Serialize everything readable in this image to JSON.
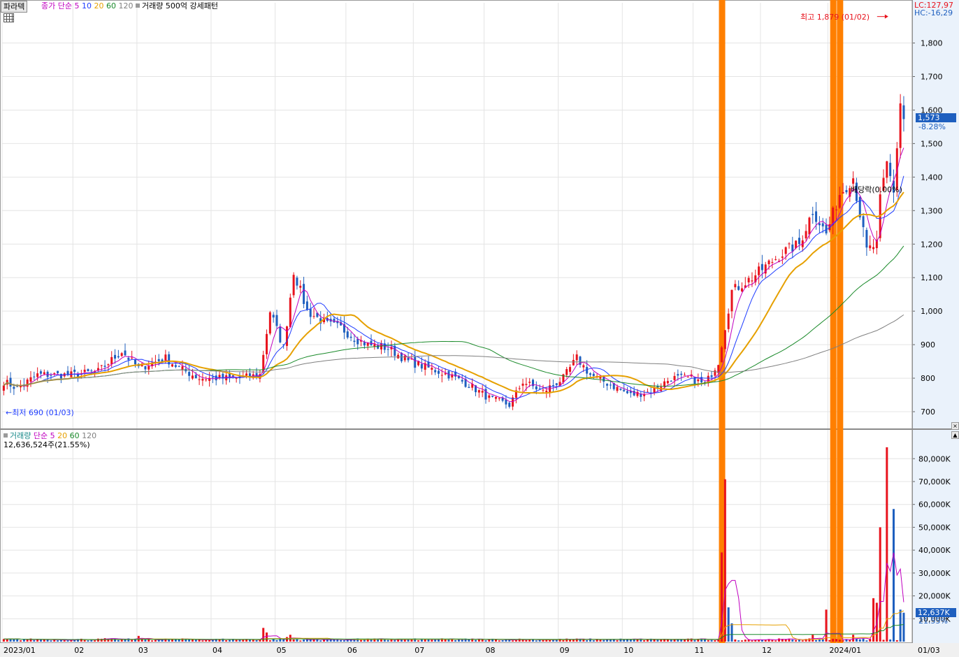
{
  "header": {
    "stock_name": "파라텍",
    "price_legend": {
      "label": "종가 단순",
      "periods": [
        {
          "value": "5",
          "color": "#c000c0"
        },
        {
          "value": "10",
          "color": "#1e3cff"
        },
        {
          "value": "20",
          "color": "#e6a000"
        },
        {
          "value": "60",
          "color": "#1a8a2a"
        },
        {
          "value": "120",
          "color": "#808080"
        }
      ]
    },
    "pattern_label": "거래량 500억 강세패턴",
    "lc": "LC:127,97",
    "hc": "HC:-16,29"
  },
  "volume_header": {
    "label": "거래량",
    "ma_label": "단순",
    "periods": [
      {
        "value": "5",
        "color": "#c000c0"
      },
      {
        "value": "20",
        "color": "#e6a000"
      },
      {
        "value": "60",
        "color": "#1a8a2a"
      },
      {
        "value": "120",
        "color": "#808080"
      }
    ],
    "summary": "12,636,524주(21.55%)"
  },
  "annotations": {
    "high": "최고 1,879 (01/02)",
    "low": "최저 690 (01/03)",
    "dividend": "배당락(0.00%)"
  },
  "current_price": {
    "value": "1,573",
    "change": "-8.28%"
  },
  "current_volume": {
    "value": "12,637K",
    "change": "21.55%"
  },
  "colors": {
    "up": "#e8121c",
    "down": "#1e5fbf",
    "signal": "#ff7f00",
    "grid": "#e4e4e4",
    "axis_bg": "#eaf2fb"
  },
  "chart_data": {
    "type": "candlestick",
    "price_axis": {
      "ticks": [
        700,
        800,
        900,
        1000,
        1100,
        1200,
        1300,
        1400,
        1500,
        1600,
        1700,
        1800
      ],
      "tick_labels": [
        "700",
        "800",
        "900",
        "1,000",
        "1,100",
        "1,200",
        "1,300",
        "1,400",
        "1,500",
        "1,600",
        "1,700",
        "1,800"
      ],
      "range": [
        650,
        1920
      ]
    },
    "volume_axis": {
      "ticks": [
        10000,
        20000,
        30000,
        40000,
        50000,
        60000,
        70000,
        80000
      ],
      "tick_labels": [
        "10,000K",
        "20,000K",
        "30,000K",
        "40,000K",
        "50,000K",
        "60,000K",
        "70,000K",
        "80,000K"
      ],
      "unit": "K",
      "range": [
        0,
        92000
      ]
    },
    "x_axis": {
      "labels": [
        "2023/01",
        "02",
        "03",
        "04",
        "05",
        "06",
        "07",
        "08",
        "09",
        "10",
        "11",
        "12",
        "2024/01",
        "01/03"
      ],
      "label_day_index": [
        0,
        21,
        40,
        62,
        81,
        102,
        122,
        143,
        165,
        184,
        205,
        225,
        245,
        254
      ]
    },
    "signal_day_index": [
      213,
      246,
      248
    ],
    "keypoints": [
      [
        0,
        790
      ],
      [
        4,
        770
      ],
      [
        10,
        810
      ],
      [
        20,
        810
      ],
      [
        28,
        820
      ],
      [
        35,
        880
      ],
      [
        40,
        830
      ],
      [
        48,
        860
      ],
      [
        52,
        830
      ],
      [
        58,
        800
      ],
      [
        64,
        800
      ],
      [
        70,
        800
      ],
      [
        76,
        810
      ],
      [
        79,
        1000
      ],
      [
        83,
        890
      ],
      [
        86,
        1120
      ],
      [
        90,
        1000
      ],
      [
        96,
        960
      ],
      [
        100,
        950
      ],
      [
        104,
        920
      ],
      [
        108,
        900
      ],
      [
        114,
        890
      ],
      [
        120,
        850
      ],
      [
        126,
        830
      ],
      [
        132,
        810
      ],
      [
        138,
        780
      ],
      [
        144,
        740
      ],
      [
        150,
        720
      ],
      [
        154,
        790
      ],
      [
        160,
        760
      ],
      [
        166,
        800
      ],
      [
        170,
        860
      ],
      [
        174,
        810
      ],
      [
        180,
        780
      ],
      [
        186,
        750
      ],
      [
        192,
        760
      ],
      [
        198,
        800
      ],
      [
        204,
        800
      ],
      [
        208,
        780
      ],
      [
        212,
        850
      ],
      [
        216,
        1060
      ],
      [
        222,
        1100
      ],
      [
        228,
        1150
      ],
      [
        232,
        1180
      ],
      [
        236,
        1200
      ],
      [
        240,
        1300
      ],
      [
        244,
        1230
      ],
      [
        248,
        1350
      ],
      [
        252,
        1400
      ],
      [
        256,
        1180
      ],
      [
        259,
        1200
      ],
      [
        260,
        1330
      ],
      [
        262,
        1440
      ],
      [
        264,
        1360
      ],
      [
        266,
        1620
      ],
      [
        267,
        1573
      ]
    ],
    "volume_events": [
      [
        213,
        39000,
        "up"
      ],
      [
        214,
        71000,
        "up"
      ],
      [
        215,
        15000,
        "down"
      ],
      [
        216,
        8000,
        "down"
      ],
      [
        240,
        3000,
        "up"
      ],
      [
        244,
        14000,
        "up"
      ],
      [
        252,
        3000,
        "up"
      ],
      [
        258,
        19000,
        "up"
      ],
      [
        259,
        17000,
        "up"
      ],
      [
        260,
        50000,
        "up"
      ],
      [
        262,
        85000,
        "up"
      ],
      [
        264,
        58000,
        "down"
      ],
      [
        266,
        14000,
        "down"
      ],
      [
        267,
        12637,
        "down"
      ],
      [
        77,
        6000,
        "up"
      ],
      [
        78,
        4000,
        "up"
      ],
      [
        84,
        2000,
        "up"
      ],
      [
        85,
        3000,
        "up"
      ],
      [
        40,
        2500,
        "up"
      ],
      [
        30,
        1500,
        "up"
      ]
    ],
    "series_ma": [
      "5",
      "10",
      "20",
      "60",
      "120"
    ]
  }
}
